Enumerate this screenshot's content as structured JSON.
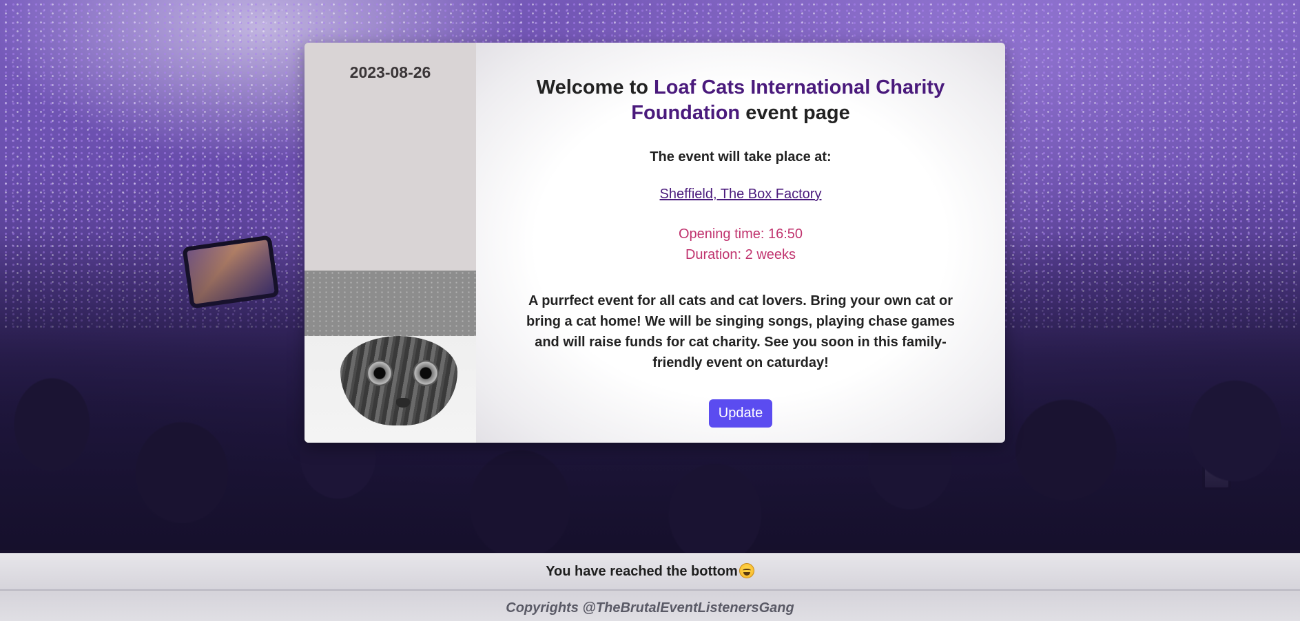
{
  "event": {
    "date": "2023-08-26",
    "welcome_prefix": "Welcome to",
    "organization": "Loaf Cats International Charity Foundation",
    "welcome_suffix": "event page",
    "venue_label": "The event will take place at:",
    "venue": "Sheffield, The Box Factory",
    "opening_time": "Opening time: 16:50",
    "duration": "Duration: 2 weeks",
    "description": "A purrfect event for all cats and cat lovers. Bring your own cat or bring a cat home! We will be singing songs, playing chase games and will raise funds for cat charity. See you soon in this family-friendly event on caturday!",
    "update_label": "Update"
  },
  "footer": {
    "bottom_message": "You have reached the bottom",
    "bottom_emoji": "laughing-face-icon",
    "copyright": "Copyrights @TheBrutalEventListenersGang"
  },
  "colors": {
    "accent": "#4a1a7c",
    "time_text": "#c0336e",
    "button": "#5b4cf0"
  }
}
